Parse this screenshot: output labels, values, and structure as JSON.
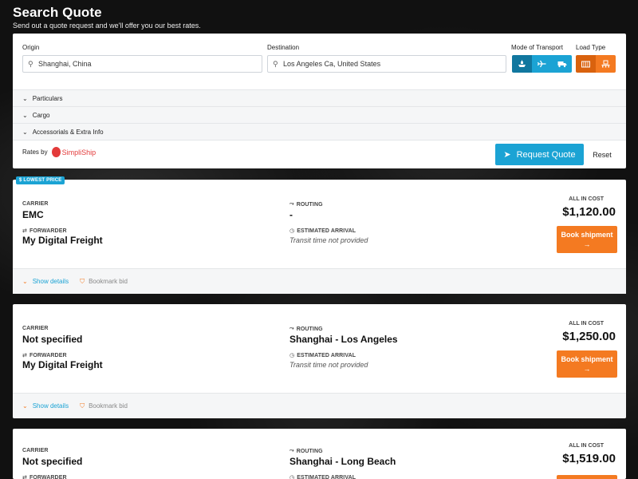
{
  "header": {
    "title": "Search Quote",
    "subtitle": "Send out a quote request and we'll offer you our best rates."
  },
  "search": {
    "origin_label": "Origin",
    "origin_value": "Shanghai, China",
    "destination_label": "Destination",
    "destination_value": "Los Angeles Ca, United States",
    "mode_label": "Mode of Transport",
    "load_label": "Load Type",
    "particulars_label": "Particulars",
    "cargo_label": "Cargo",
    "accessorials_label": "Accessorials & Extra Info",
    "rates_by_label": "Rates by",
    "rates_provider": "SimpliShip",
    "request_label": "Request Quote",
    "reset_label": "Reset",
    "mode_icons": [
      "ship-icon",
      "plane-icon",
      "truck-icon"
    ],
    "load_icons": [
      "container-icon",
      "pallet-icon"
    ]
  },
  "labels": {
    "carrier": "CARRIER",
    "forwarder": "FORWARDER",
    "routing": "ROUTING",
    "estimated_arrival": "ESTIMATED ARRIVAL",
    "all_in_cost": "ALL IN COST",
    "book": "Book shipment",
    "book_arrow": "→",
    "show_details": "Show details",
    "bookmark": "Bookmark bid",
    "lowest_price": "$ LOWEST PRICE"
  },
  "results": [
    {
      "carrier": "EMC",
      "forwarder": "My Digital Freight",
      "routing": "-",
      "arrival": "Transit time not provided",
      "cost": "$1,120.00",
      "lowest": true
    },
    {
      "carrier": "Not specified",
      "forwarder": "My Digital Freight",
      "routing": "Shanghai - Los Angeles",
      "arrival": "Transit time not provided",
      "cost": "$1,250.00",
      "lowest": false
    },
    {
      "carrier": "Not specified",
      "forwarder": "",
      "routing": "Shanghai - Long Beach",
      "arrival": "",
      "cost": "$1,519.00",
      "lowest": false
    }
  ],
  "colors": {
    "accent_blue": "#1ba3d4",
    "accent_orange": "#f47a21"
  }
}
